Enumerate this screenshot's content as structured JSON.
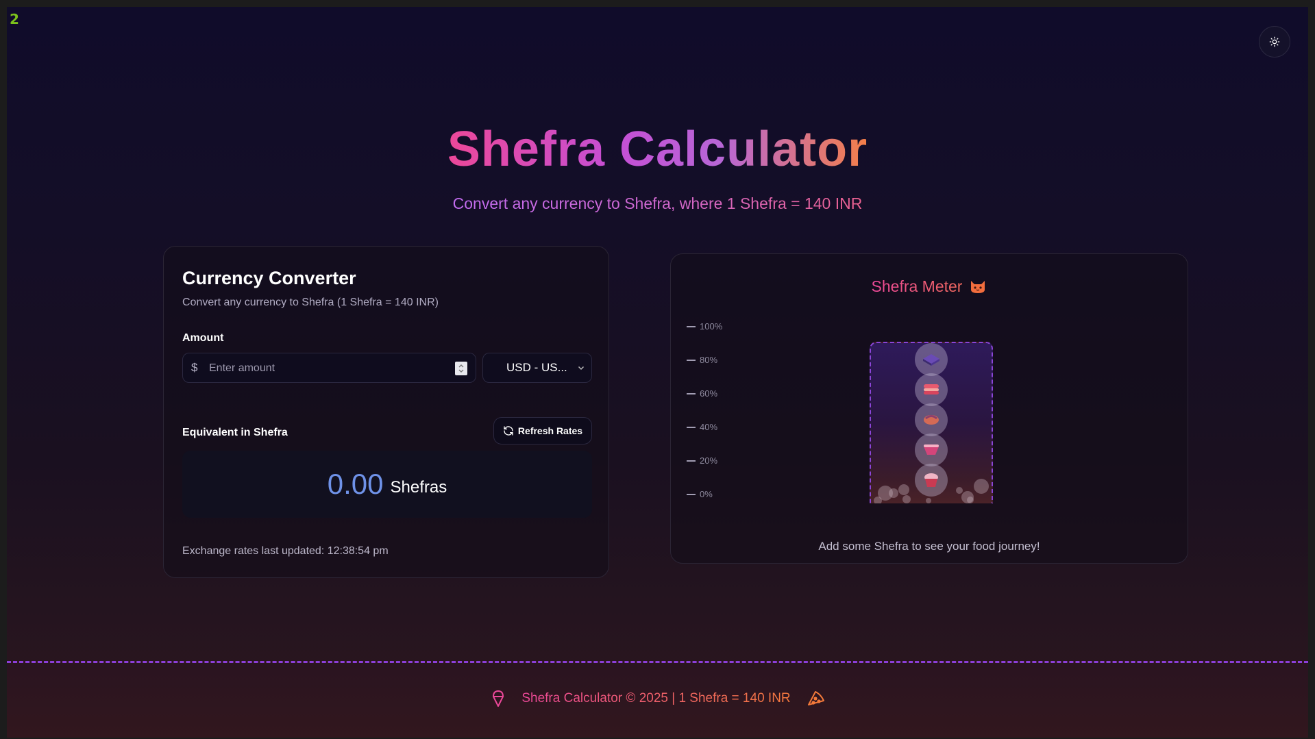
{
  "frame_index": "2",
  "header": {
    "title": "Shefra Calculator",
    "subtitle": "Convert any currency to Shefra, where 1 Shefra = 140 INR",
    "theme_toggle_icon": "sun-icon"
  },
  "converter": {
    "title": "Currency Converter",
    "description": "Convert any currency to Shefra (1 Shefra = 140 INR)",
    "amount_label": "Amount",
    "currency_symbol": "$",
    "amount_value": "",
    "amount_placeholder": "Enter amount",
    "currency_selected": "USD - US...",
    "equivalent_label": "Equivalent in Shefra",
    "refresh_label": "Refresh Rates",
    "result_value": "0.00",
    "result_unit": "Shefras",
    "rates_updated": "Exchange rates last updated: 12:38:54 pm"
  },
  "meter": {
    "title": "Shefra Meter",
    "title_icon": "cat-icon",
    "scale": [
      "100%",
      "80%",
      "60%",
      "40%",
      "20%",
      "0%"
    ],
    "fill_level": 0,
    "food_items": [
      "sandwich-icon",
      "sushi-icon",
      "dumpling-icon",
      "cake-slice-icon",
      "cupcake-icon"
    ],
    "caption": "Add some Shefra to see your food journey!"
  },
  "footer": {
    "text": "Shefra Calculator © 2025 | 1 Shefra = 140 INR",
    "left_icon": "ice-cream-icon",
    "right_icon": "pizza-icon"
  },
  "colors": {
    "accent_pink": "#ec4899",
    "accent_purple": "#a855f7",
    "accent_orange": "#f97316",
    "result_blue": "#6f92e8",
    "dashed_border": "#8b45d6"
  }
}
